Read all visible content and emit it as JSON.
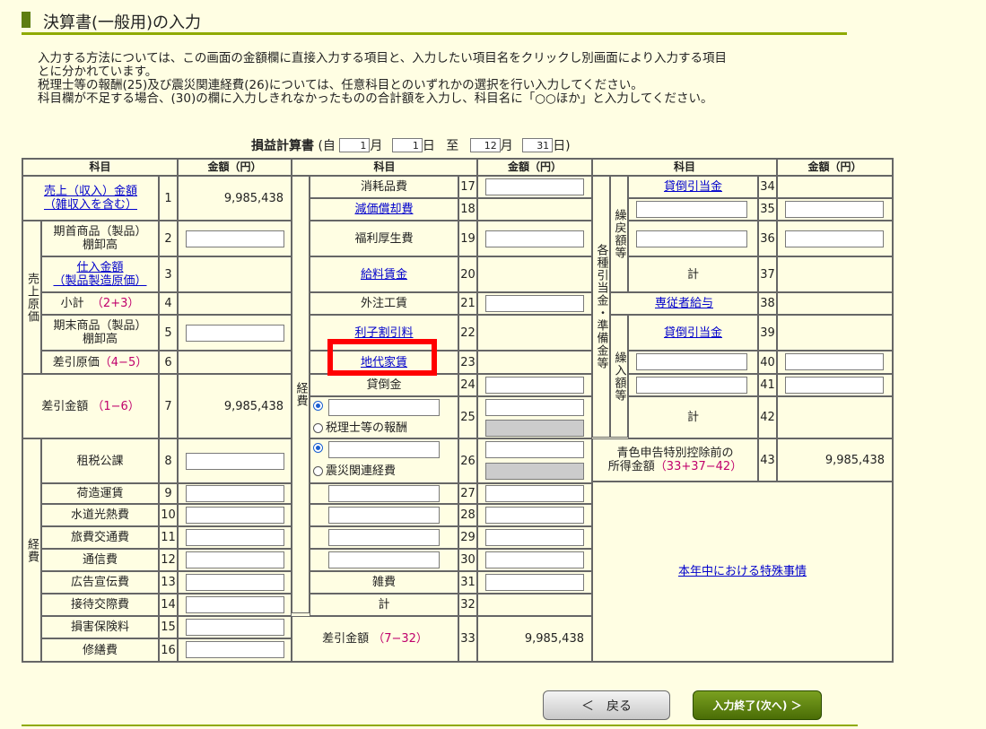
{
  "page": {
    "title": "決算書(一般用)の入力"
  },
  "intro": [
    "入力する方法については、この画面の金額欄に直接入力する項目と、入力したい項目名をクリックし別画面により入力する項目",
    "とに分かれています。",
    "税理士等の報酬(25)及び震災関連経費(26)については、任意科目とのいずれかの選択を行い入力してください。",
    "科目欄が不足する場合、(30)の欄に入力しきれなかったものの合計額を入力し、科目名に「○○ほか」と入力してください。"
  ],
  "period": {
    "label": "損益計算書",
    "open": "(自",
    "from_month": "1",
    "month_unit": "月",
    "from_day": "1",
    "day_unit": "日",
    "to_label": "至",
    "to_month": "12",
    "to_day": "31",
    "close": "日)"
  },
  "headers": {
    "kamoku": "科目",
    "kingaku": "金額（円）"
  },
  "groups": {
    "uriage_genka": "売上原価",
    "keihi_left": "経費",
    "keihi_mid": "経費",
    "kakushu": "各種引当金・準備金等",
    "kurimodoshi": "繰戻額等",
    "kuriire": "繰入額等"
  },
  "left": {
    "r1": {
      "label1": "売上（収入）金額",
      "label2": "（雑収入を含む）",
      "no": "1",
      "amount": "9,985,438"
    },
    "r2": {
      "label1": "期首商品（製品）",
      "label2": "棚卸高",
      "no": "2"
    },
    "r3": {
      "label1": "仕入金額",
      "label2": "（製品製造原価）",
      "no": "3"
    },
    "r4": {
      "label": "小計",
      "formula": "（2+3）",
      "no": "4"
    },
    "r5": {
      "label1": "期末商品（製品）",
      "label2": "棚卸高",
      "no": "5"
    },
    "r6": {
      "label": "差引原価",
      "formula": "（4−5）",
      "no": "6"
    },
    "r7": {
      "label": "差引金額",
      "formula": "（1−6）",
      "no": "7",
      "amount": "9,985,438"
    },
    "r8": {
      "label": "租税公課",
      "no": "8"
    },
    "r9": {
      "label": "荷造運賃",
      "no": "9"
    },
    "r10": {
      "label": "水道光熱費",
      "no": "10"
    },
    "r11": {
      "label": "旅費交通費",
      "no": "11"
    },
    "r12": {
      "label": "通信費",
      "no": "12"
    },
    "r13": {
      "label": "広告宣伝費",
      "no": "13"
    },
    "r14": {
      "label": "接待交際費",
      "no": "14"
    },
    "r15": {
      "label": "損害保険料",
      "no": "15"
    },
    "r16": {
      "label": "修繕費",
      "no": "16"
    }
  },
  "mid": {
    "r17": {
      "label": "消耗品費",
      "no": "17"
    },
    "r18": {
      "label": "減価償却費",
      "no": "18"
    },
    "r19": {
      "label": "福利厚生費",
      "no": "19"
    },
    "r20": {
      "label": "給料賃金",
      "no": "20"
    },
    "r21": {
      "label": "外注工賃",
      "no": "21"
    },
    "r22": {
      "label": "利子割引料",
      "no": "22"
    },
    "r23": {
      "label": "地代家賃",
      "no": "23"
    },
    "r24": {
      "label": "貸倒金",
      "no": "24"
    },
    "r25": {
      "radio_label": "税理士等の報酬",
      "no": "25"
    },
    "r26": {
      "radio_label": "震災関連経費",
      "no": "26"
    },
    "r27": {
      "no": "27"
    },
    "r28": {
      "no": "28"
    },
    "r29": {
      "no": "29"
    },
    "r30": {
      "no": "30"
    },
    "r31": {
      "label": "雑費",
      "no": "31"
    },
    "r32": {
      "label": "計",
      "no": "32"
    },
    "r33": {
      "label": "差引金額",
      "formula": "（7−32）",
      "no": "33",
      "amount": "9,985,438"
    }
  },
  "right": {
    "r34": {
      "label": "貸倒引当金",
      "no": "34"
    },
    "r35": {
      "no": "35"
    },
    "r36": {
      "no": "36"
    },
    "r37": {
      "label": "計",
      "no": "37"
    },
    "r38": {
      "label": "専従者給与",
      "no": "38"
    },
    "r39": {
      "label": "貸倒引当金",
      "no": "39"
    },
    "r40": {
      "no": "40"
    },
    "r41": {
      "no": "41"
    },
    "r42": {
      "label": "計",
      "no": "42"
    },
    "r43": {
      "label1": "青色申告特別控除前の",
      "label2": "所得金額",
      "formula": "（33+37−42）",
      "no": "43",
      "amount": "9,985,438"
    },
    "special_link": "本年中における特殊事情"
  },
  "buttons": {
    "back": "＜　戻る",
    "next": "入力終了(次へ) ＞"
  }
}
